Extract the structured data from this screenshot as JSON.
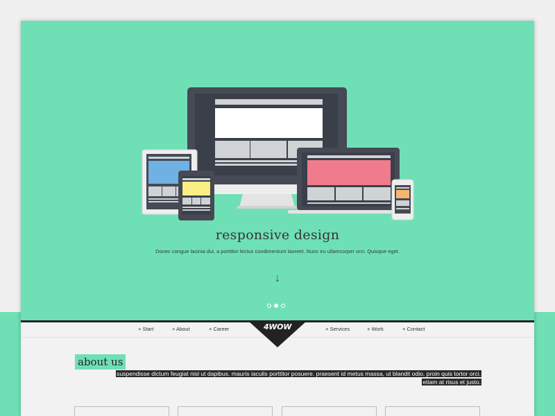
{
  "hero": {
    "title": "responsive design",
    "text": "Donec congue lacinia dui, a porttitor lectus condimentum laoreet. Nunc eu ullamcorper orci. Quisque eget.",
    "arrow": "↓",
    "slides": {
      "count": 3,
      "active": 2
    }
  },
  "nav": {
    "logo": "4WOW",
    "left_items": [
      "+ Start",
      "+ About",
      "+ Career"
    ],
    "right_items": [
      "+ Services",
      "+ Work",
      "+ Contact"
    ]
  },
  "about": {
    "title": "about us",
    "text": "suspendisse dictum feugiat nisl ut dapibus. mauris iaculis porttitor posuere. praesent id metus massa, ut blandit odio. proin quis tortor orci. etiam at risus et justo."
  },
  "colors": {
    "accent": "#6fe0b6",
    "dark": "#2a2a2a",
    "device_frame": "#454a55",
    "blue": "#6fb1e3",
    "yellow": "#fbee84",
    "pink": "#ef7b8c",
    "orange": "#f6b76c"
  },
  "icons": [
    "monitor-icon",
    "tablet-icon",
    "laptop-icon",
    "phone-icon",
    "arrow-down-icon"
  ]
}
